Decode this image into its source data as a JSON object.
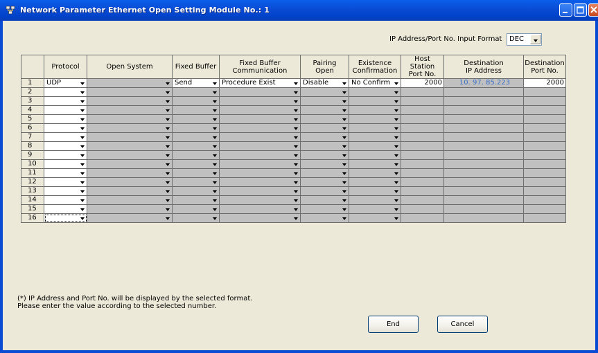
{
  "window": {
    "title": "Network Parameter  Ethernet Open Setting Module No.: 1"
  },
  "format": {
    "label": "IP Address/Port No. Input Format",
    "value": "DEC"
  },
  "columns": [
    "",
    "Protocol",
    "Open System",
    "Fixed Buffer",
    "Fixed Buffer\nCommunication",
    "Pairing\nOpen",
    "Existence\nConfirmation",
    "Host Station\nPort No.",
    "Destination\nIP Address",
    "Destination\nPort No."
  ],
  "rows": [
    {
      "n": "1",
      "protocol": "UDP",
      "open_system": "",
      "fixed_buffer": "Send",
      "fbc": "Procedure Exist",
      "pairing": "Disable",
      "existence": "No Confirm",
      "host_port": "2000",
      "dest_ip": "10. 97. 85.223",
      "dest_port": "2000"
    },
    {
      "n": "2"
    },
    {
      "n": "3"
    },
    {
      "n": "4"
    },
    {
      "n": "5"
    },
    {
      "n": "6"
    },
    {
      "n": "7"
    },
    {
      "n": "8"
    },
    {
      "n": "9"
    },
    {
      "n": "10"
    },
    {
      "n": "11"
    },
    {
      "n": "12"
    },
    {
      "n": "13"
    },
    {
      "n": "14"
    },
    {
      "n": "15"
    },
    {
      "n": "16"
    }
  ],
  "note": {
    "line1": "(*) IP Address and Port No. will be displayed by the selected format.",
    "line2": "Please enter the value according to the selected number."
  },
  "buttons": {
    "end": "End",
    "cancel": "Cancel"
  }
}
